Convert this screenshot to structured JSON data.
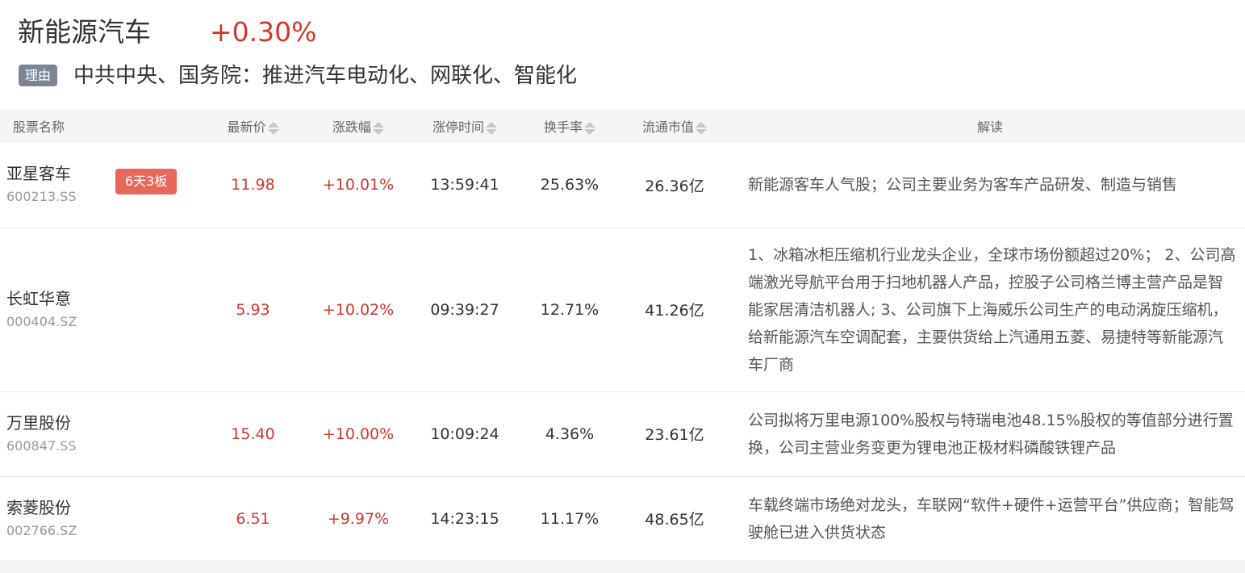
{
  "header": {
    "sector_name": "新能源汽车",
    "sector_change": "+0.30%",
    "reason_label": "理由",
    "reason_text": "中共中央、国务院：推进汽车电动化、网联化、智能化"
  },
  "table": {
    "columns": {
      "name": "股票名称",
      "price": "最新价",
      "change": "涨跌幅",
      "limit_time": "涨停时间",
      "turnover": "换手率",
      "market_cap": "流通市值",
      "analysis": "解读"
    },
    "rows": [
      {
        "name": "亚星客车",
        "code": "600213.SS",
        "badge": "6天3板",
        "price": "11.98",
        "change": "+10.01%",
        "limit_time": "13:59:41",
        "turnover": "25.63%",
        "market_cap": "26.36亿",
        "analysis": "新能源客车人气股；公司主要业务为客车产品研发、制造与销售"
      },
      {
        "name": "长虹华意",
        "code": "000404.SZ",
        "badge": "",
        "price": "5.93",
        "change": "+10.02%",
        "limit_time": "09:39:27",
        "turnover": "12.71%",
        "market_cap": "41.26亿",
        "analysis": "1、冰箱冰柜压缩机行业龙头企业，全球市场份额超过20%； 2、公司高端激光导航平台用于扫地机器人产品，控股子公司格兰博主营产品是智能家居清洁机器人; 3、公司旗下上海威乐公司生产的电动涡旋压缩机，给新能源汽车空调配套，主要供货给上汽通用五菱、易捷特等新能源汽车厂商"
      },
      {
        "name": "万里股份",
        "code": "600847.SS",
        "badge": "",
        "price": "15.40",
        "change": "+10.00%",
        "limit_time": "10:09:24",
        "turnover": "4.36%",
        "market_cap": "23.61亿",
        "analysis": "公司拟将万里电源100%股权与特瑞电池48.15%股权的等值部分进行置换，公司主营业务变更为锂电池正极材料磷酸铁锂产品"
      },
      {
        "name": "索菱股份",
        "code": "002766.SZ",
        "badge": "",
        "price": "6.51",
        "change": "+9.97%",
        "limit_time": "14:23:15",
        "turnover": "11.17%",
        "market_cap": "48.65亿",
        "analysis": "车载终端市场绝对龙头，车联网“软件+硬件+运营平台”供应商；智能驾驶舱已进入供货状态"
      }
    ]
  },
  "colors": {
    "up_red": "#d0392e",
    "badge_red": "#e8685c",
    "reason_badge_gray": "#7d8595",
    "header_bg": "#f5f5f5"
  },
  "icons": {
    "sort": "sort-updown-icon"
  }
}
